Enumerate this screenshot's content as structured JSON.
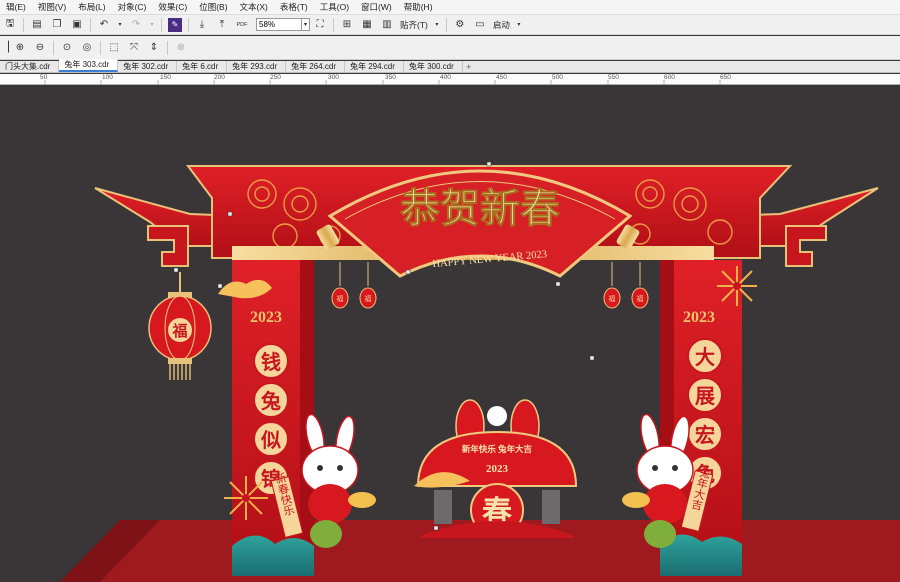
{
  "menu": [
    "辑(E)",
    "视图(V)",
    "布局(L)",
    "对象(C)",
    "效果(C)",
    "位图(B)",
    "文本(X)",
    "表格(T)",
    "工具(O)",
    "窗口(W)",
    "帮助(H)"
  ],
  "toolbar": {
    "pdf_label": "PDF",
    "zoom": "58%",
    "snap_label": "贴齐(T)",
    "launch_label": "启动"
  },
  "tabs": [
    "门头大集.cdr",
    "兔年 303.cdr",
    "兔年 302.cdr",
    "兔年 6.cdr",
    "兔年 293.cdr",
    "兔年 264.cdr",
    "兔年 294.cdr",
    "兔年 300.cdr"
  ],
  "active_tab": 1,
  "ruler": [
    "50",
    "100",
    "150",
    "200",
    "250",
    "300",
    "350",
    "400",
    "450",
    "500",
    "550",
    "600",
    "650"
  ],
  "artwork": {
    "title": "恭贺新春",
    "subtitle": "HAPPY NEW YEAR 2023",
    "lantern": "福",
    "small_lantern": "福",
    "year": "2023",
    "left_couplet": [
      "钱",
      "兔",
      "似",
      "锦"
    ],
    "right_couplet": [
      "大",
      "展",
      "宏",
      "兔"
    ],
    "left_scroll": "新春快乐",
    "right_scroll": "兔年大吉",
    "badge_text": "新年快乐 兔年大吉",
    "badge_year": "2023",
    "spring": "春"
  },
  "colors": {
    "canvas_bg": "#3a3536",
    "red": "#c8161e",
    "gold": "#e9c27a",
    "floor": "#9e1a1e"
  }
}
